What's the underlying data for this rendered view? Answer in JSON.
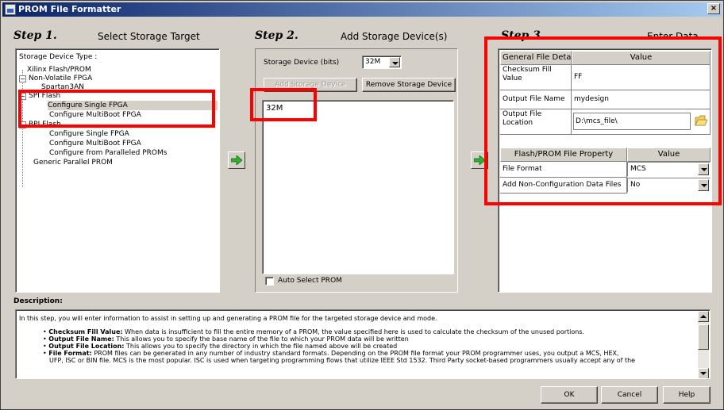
{
  "window": {
    "title": "PROM File Formatter",
    "close_glyph": "×"
  },
  "step1": {
    "label": "Step 1.",
    "title": "Select Storage Target",
    "tree_header": "Storage Device Type :",
    "tree": [
      {
        "label": "Xilinx Flash/PROM",
        "expander": ""
      },
      {
        "label": "Non-Volatile FPGA",
        "expander": "−"
      },
      {
        "label": "Spartan3AN",
        "expander": ""
      },
      {
        "label": "SPI Flash",
        "expander": "−"
      },
      {
        "label": "Configure Single FPGA",
        "expander": ""
      },
      {
        "label": "Configure MultiBoot FPGA",
        "expander": ""
      },
      {
        "label": "BPI Flash",
        "expander": "−"
      },
      {
        "label": "Configure Single FPGA",
        "expander": ""
      },
      {
        "label": "Configure MultiBoot FPGA",
        "expander": ""
      },
      {
        "label": "Configure from Paralleled PROMs",
        "expander": ""
      },
      {
        "label": "Generic Parallel PROM",
        "expander": ""
      }
    ]
  },
  "step2": {
    "label": "Step 2.",
    "title": "Add Storage Device(s)",
    "storage_device_label": "Storage Device (bits)",
    "storage_device_value": "32M",
    "add_button": "Add Storage Device",
    "remove_button": "Remove Storage Device",
    "devices": [
      "32M"
    ],
    "auto_select_label": "Auto Select PROM"
  },
  "step3": {
    "label": "Step 3.",
    "title": "Enter Data",
    "general_header": "General File Detail",
    "general_value_header": "Value",
    "checksum_label": "Checksum Fill Value",
    "checksum_value": "FF",
    "output_name_label": "Output File Name",
    "output_name_value": "mydesign",
    "output_location_label": "Output File Location",
    "output_location_value": "D:\\mcs_file\\",
    "flash_header": "Flash/PROM File Property",
    "flash_value_header": "Value",
    "file_format_label": "File Format",
    "file_format_value": "MCS",
    "add_nonconfig_label": "Add Non-Configuration Data Files",
    "add_nonconfig_value": "No"
  },
  "description": {
    "label": "Description:",
    "intro": "In this step, you will enter information to assist in setting up and generating a PROM file for the targeted storage device and mode.",
    "items": [
      {
        "term": "Checksum Fill Value:",
        "text": "When data is insufficient to fill the entire memory of a PROM, the value specified here is used to calculate the checksum of the unused portions."
      },
      {
        "term": "Output File Name:",
        "text": "This allows you to specify the base name of the file to which your PROM data will be written"
      },
      {
        "term": "Output File Location:",
        "text": "This allows you to specify the directory in which the file named above will be created"
      },
      {
        "term": "File Format:",
        "text": "PROM files can be generated in any number of industry standard formats. Depending on the PROM file format your PROM programmer uses, you output a MCS, HEX,"
      },
      {
        "term": "",
        "text": "UFP, ISC or BIN file. MCS is the most popular. ISC is used when targeting programming flows that utilize IEEE Std 1532. Third Party socket-based programmers usually accept any of the"
      }
    ]
  },
  "buttons": {
    "ok": "OK",
    "cancel": "Cancel",
    "help": "Help"
  },
  "highlight_color": "#ff0000"
}
